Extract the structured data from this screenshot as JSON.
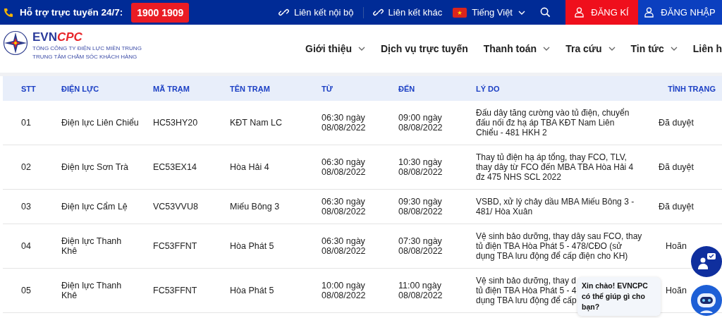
{
  "topbar": {
    "hotline_label": "Hỗ trợ trực tuyến 24/7:",
    "hotline": "1900 1909",
    "links": [
      "Liên kết nội bộ",
      "Liên kết khác"
    ],
    "language": "Tiếng Việt",
    "register": "ĐĂNG KÍ",
    "login": "ĐĂNG NHẬP"
  },
  "logo": {
    "brand_a": "EVN",
    "brand_b": "CPC",
    "line1": "TỔNG CÔNG TY ĐIỆN LỰC MIỀN TRUNG",
    "line2": "TRUNG TÂM CHĂM SÓC KHÁCH HÀNG"
  },
  "nav": [
    {
      "label": "Giới thiệu",
      "has_menu": true
    },
    {
      "label": "Dịch vụ trực tuyến",
      "has_menu": false
    },
    {
      "label": "Thanh toán",
      "has_menu": true
    },
    {
      "label": "Tra cứu",
      "has_menu": true
    },
    {
      "label": "Tin tức",
      "has_menu": true
    },
    {
      "label": "Liên h",
      "has_menu": false
    }
  ],
  "table": {
    "columns": [
      "STT",
      "ĐIỆN LỰC",
      "MÃ TRẠM",
      "TÊN TRẠM",
      "TỪ",
      "ĐẾN",
      "LÝ DO",
      "TÌNH TRẠNG"
    ],
    "rows": [
      {
        "stt": "01",
        "unit": "Điện lực Liên Chiểu",
        "code": "HC53HY20",
        "station": "KĐT Nam LC",
        "from": "06:30 ngày 08/08/2022",
        "to": "09:00 ngày 08/08/2022",
        "reason": [
          "Đấu dây tăng cường vào tủ điện, chuyển",
          "đấu nối đz hạ áp TBA KĐT Nam Liên",
          "Chiểu - 481 HKH 2"
        ],
        "status": "Đã duyệt"
      },
      {
        "stt": "02",
        "unit": "Điện lực Sơn Trà",
        "code": "EC53EX14",
        "station": "Hòa Hải 4",
        "from": "06:30 ngày 08/08/2022",
        "to": "10:30 ngày 08/08/2022",
        "reason": [
          "Thay tủ điện hạ áp tổng, thay FCO, TLV,",
          "thay dây từ FCO đến MBA TBA Hòa Hải 4",
          "đz 475 NHS SCL 2022"
        ],
        "status": "Đã duyệt"
      },
      {
        "stt": "03",
        "unit": "Điện lực Cẩm Lệ",
        "code": "VC53VVU8",
        "station": "Miếu Bông 3",
        "from": "06:30 ngày 08/08/2022",
        "to": "09:30 ngày 08/08/2022",
        "reason": [
          "VSBD, xử lý chảy dầu MBA Miếu Bông 3 -",
          "481/ Hòa Xuân"
        ],
        "status": "Đã duyệt"
      },
      {
        "stt": "04",
        "unit": "Điện lực Thanh Khê",
        "code": "FC53FFNT",
        "station": "Hòa Phát 5",
        "from": "06:30 ngày 08/08/2022",
        "to": "07:30 ngày 08/08/2022",
        "reason": [
          "Vệ sinh bảo dưỡng, thay dây sau FCO, thay",
          "tủ điện TBA Hòa Phát 5 - 478/CĐO (sử",
          "dụng TBA lưu động để cấp điện cho KH)"
        ],
        "status": "Hoãn"
      },
      {
        "stt": "05",
        "unit": "Điện lực Thanh Khê",
        "code": "FC53FFNT",
        "station": "Hòa Phát 5",
        "from": "10:00 ngày 08/08/2022",
        "to": "11:00 ngày 08/08/2022",
        "reason": [
          "Vệ sinh bảo dưỡng, thay d",
          "tủ điện TBA Hòa Phát 5 - 4",
          "dụng TBA lưu động để cấp"
        ],
        "status": "Hoãn"
      }
    ]
  },
  "chat": {
    "greeting": "Xin chào! EVNCPC có thể giúp gì cho bạn?"
  }
}
